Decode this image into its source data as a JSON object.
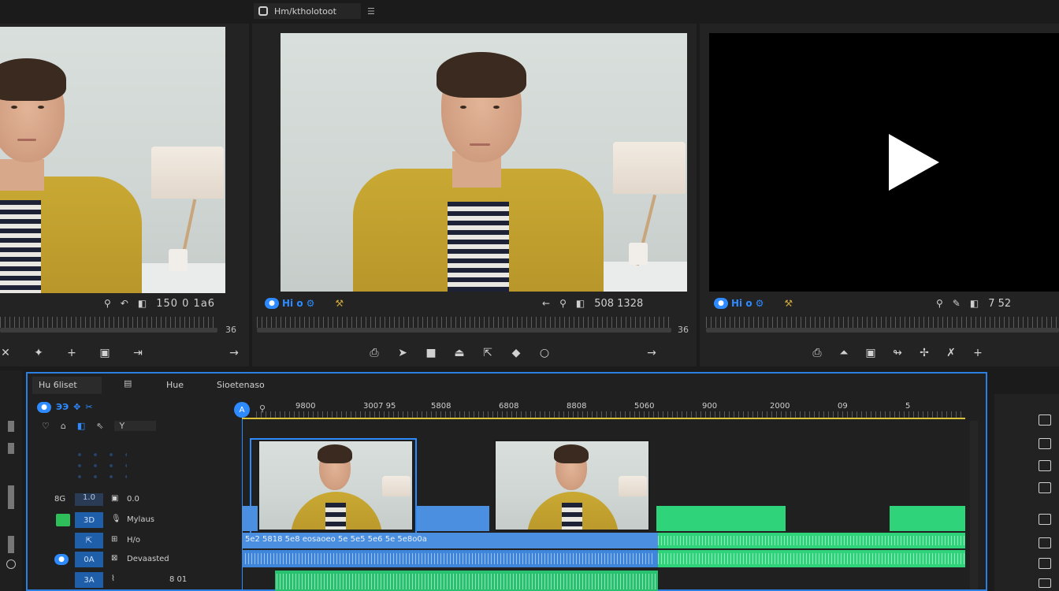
{
  "window": {
    "title": "Hm/ktholotoot"
  },
  "source_monitor": {
    "timecode": "150 0 1a6",
    "zoom": "36"
  },
  "program_monitor": {
    "label": "Hi o",
    "timecode": "508 1328",
    "zoom": "36"
  },
  "reference_monitor": {
    "label": "Hi o",
    "timecode": "7 52"
  },
  "timeline": {
    "tabs": [
      "Hu 6liset",
      "Hue",
      "Sioetenaso"
    ],
    "ruler_labels": [
      "9800",
      "3007 95",
      "5808",
      "6808",
      "8808",
      "5060",
      "900",
      "2000",
      "09",
      "5"
    ],
    "tracks": [
      {
        "id": "8G",
        "label": "0.0"
      },
      {
        "id": "3D",
        "label": "Mylaus"
      },
      {
        "id": "0A",
        "label": "H/o"
      },
      {
        "id": "0A",
        "label": "Devaasted"
      },
      {
        "id": "3A",
        "label": "8 01"
      }
    ],
    "clip_text": "5e2 5818 5e8 eosaoeo 5e 5e5 5e6 5e 5e8o0a"
  },
  "colors": {
    "accent": "#2e8bff",
    "audio_green": "#2fd37a",
    "video_blue": "#4a8fe0",
    "playhead": "#d9c23a"
  }
}
